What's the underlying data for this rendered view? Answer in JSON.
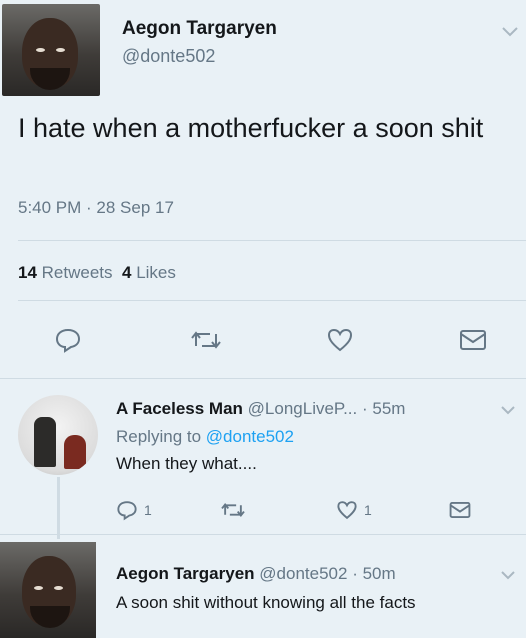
{
  "main_tweet": {
    "display_name": "Aegon Targaryen",
    "handle": "@donte502",
    "text": "I hate when a motherfucker a soon shit",
    "timestamp": "5:40 PM · 28 Sep 17",
    "retweets_count": "14",
    "retweets_label": "Retweets",
    "likes_count": "4",
    "likes_label": "Likes",
    "actions": [
      "reply-icon",
      "retweet-icon",
      "like-icon",
      "message-icon"
    ]
  },
  "reply_tweet": {
    "display_name": "A Faceless Man",
    "handle": "@LongLiveP...",
    "time": "· 55m",
    "replying_label": "Replying to",
    "replying_to": "@donte502",
    "text": "When they what....",
    "reply_count": "1",
    "like_count": "1"
  },
  "bottom_tweet": {
    "display_name": "Aegon Targaryen",
    "handle": "@donte502",
    "time": "· 50m",
    "text": "A soon shit without knowing all the facts"
  },
  "colors": {
    "background": "#e9f1f6",
    "text_primary": "#14171a",
    "text_secondary": "#657786",
    "link": "#1da1f2",
    "icon": "#657786"
  }
}
